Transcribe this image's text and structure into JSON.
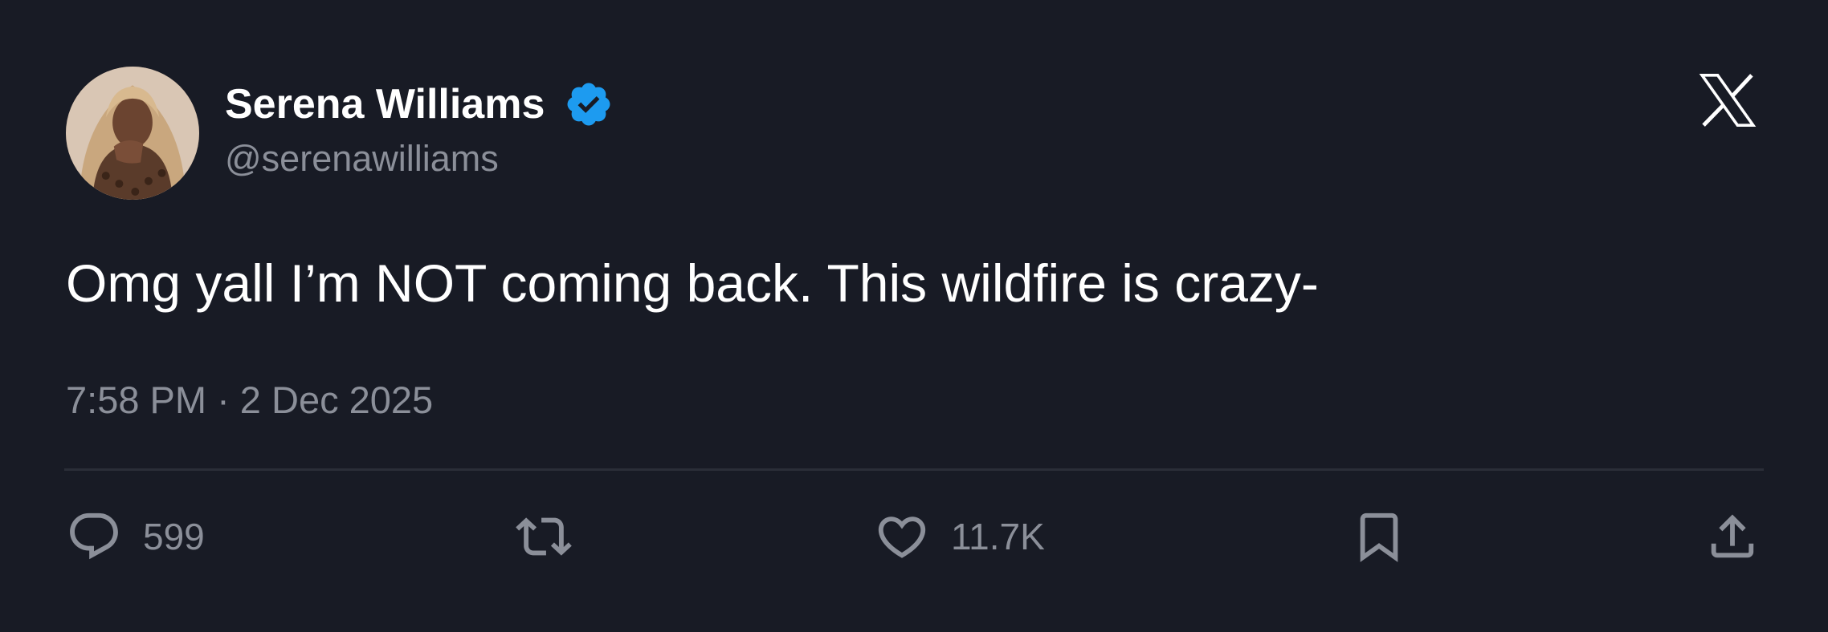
{
  "author": {
    "display_name": "Serena Williams",
    "handle": "@serenawilliams",
    "verified": true,
    "verified_color": "#1d9bf0"
  },
  "brand": {
    "logo_icon": "x-logo-icon"
  },
  "tweet": {
    "text": "Omg yall I’m NOT coming back. This wildfire is crazy-",
    "timestamp": "7:58 PM · 2 Dec 2025"
  },
  "actions": {
    "reply": {
      "icon": "reply-icon",
      "count": "599"
    },
    "retweet": {
      "icon": "retweet-icon",
      "count": ""
    },
    "like": {
      "icon": "heart-icon",
      "count": "11.7K"
    },
    "bookmark": {
      "icon": "bookmark-icon",
      "count": ""
    },
    "share": {
      "icon": "share-icon",
      "count": ""
    }
  },
  "colors": {
    "background": "#181b25",
    "text_primary": "#ffffff",
    "text_secondary": "#8b8f99",
    "divider": "#2a2e38"
  }
}
